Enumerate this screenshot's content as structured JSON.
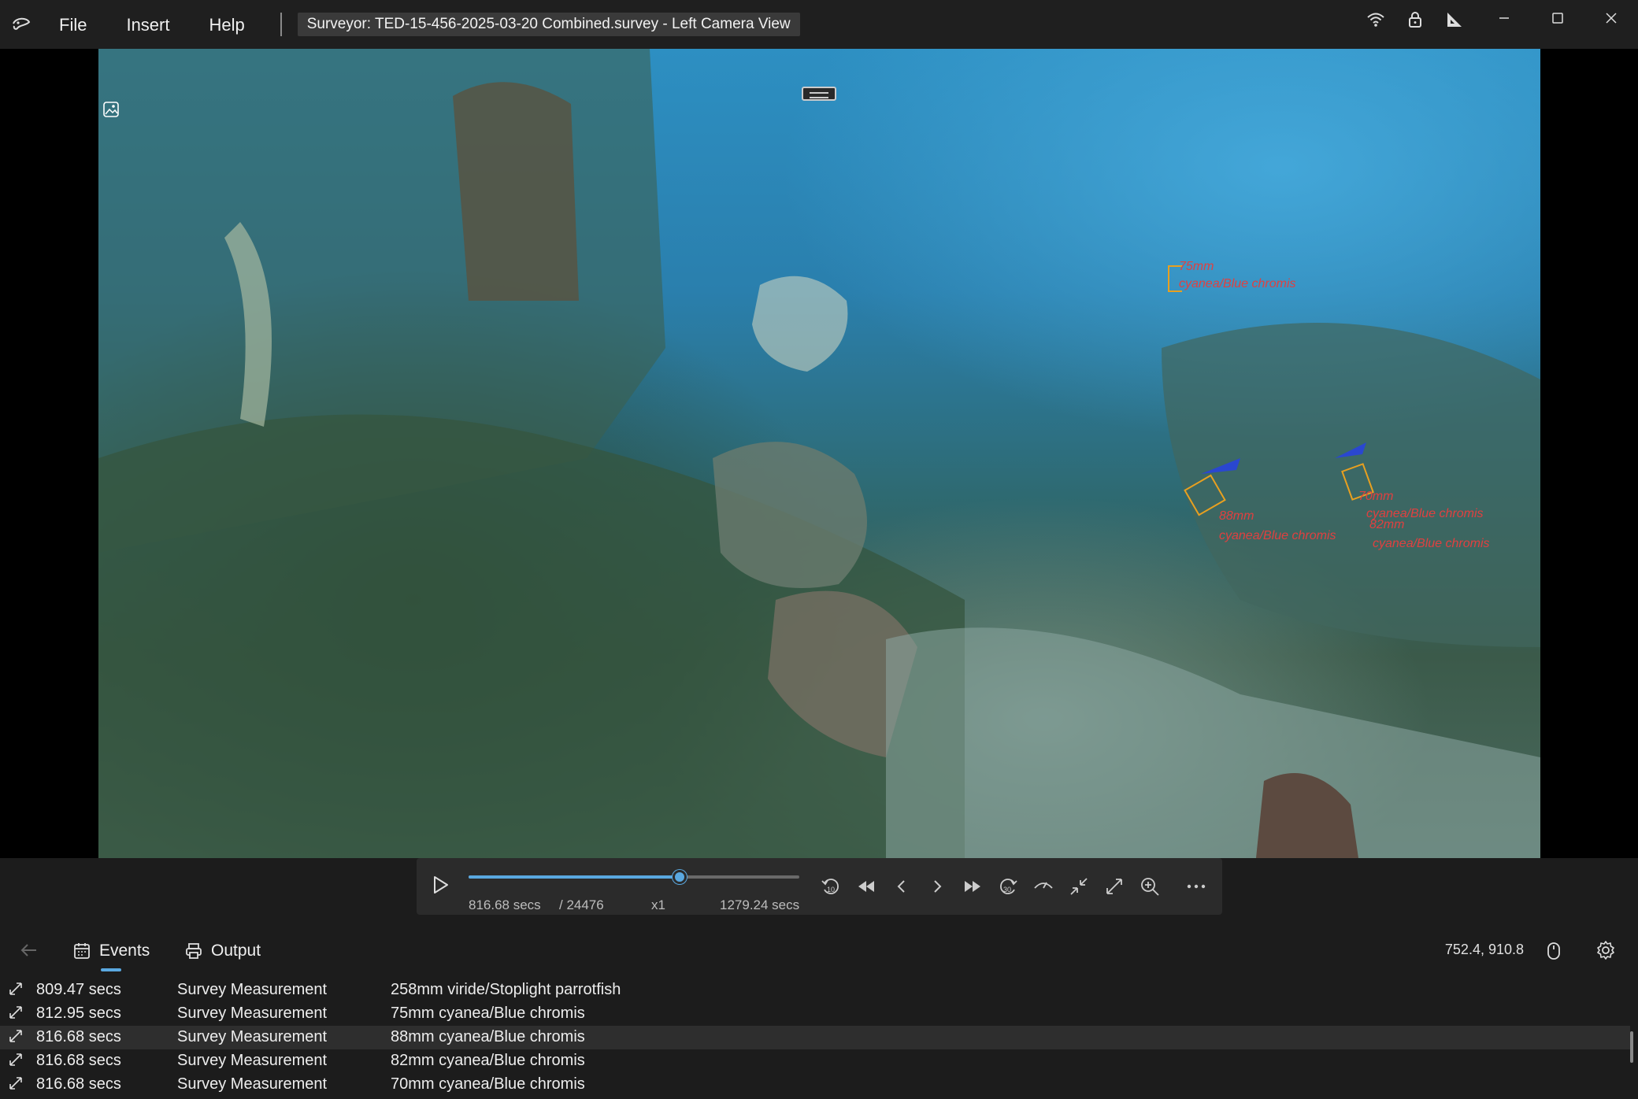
{
  "menu": {
    "file": "File",
    "insert": "Insert",
    "help": "Help"
  },
  "window_title": "Surveyor: TED-15-456-2025-03-20 Combined.survey - Left Camera View",
  "annotations": [
    {
      "label_length": "75mm",
      "label_species": "cyanea/Blue chromis"
    },
    {
      "label_length": "88mm",
      "label_species": "cyanea/Blue chromis"
    },
    {
      "label_length": "70mm",
      "label_species": "cyanea/Blue chromis"
    },
    {
      "label_length": "82mm",
      "label_species": "cyanea/Blue chromis"
    }
  ],
  "player": {
    "current_time": "816.68 secs",
    "frame": "/ 24476",
    "speed": "x1",
    "total_time": "1279.24 secs",
    "progress": 0.638
  },
  "tabs": {
    "events": "Events",
    "output": "Output"
  },
  "status": {
    "coordinates": "752.4, 910.8"
  },
  "events": [
    {
      "time": "809.47 secs",
      "type": "Survey Measurement",
      "desc": "258mm viride/Stoplight parrotfish"
    },
    {
      "time": "812.95 secs",
      "type": "Survey Measurement",
      "desc": "75mm cyanea/Blue chromis"
    },
    {
      "time": "816.68 secs",
      "type": "Survey Measurement",
      "desc": "88mm cyanea/Blue chromis"
    },
    {
      "time": "816.68 secs",
      "type": "Survey Measurement",
      "desc": "82mm cyanea/Blue chromis"
    },
    {
      "time": "816.68 secs",
      "type": "Survey Measurement",
      "desc": "70mm cyanea/Blue chromis"
    }
  ],
  "colors": {
    "accent": "#5aa8e0",
    "annotation_text": "#e04040",
    "annotation_box": "#e8a020"
  }
}
